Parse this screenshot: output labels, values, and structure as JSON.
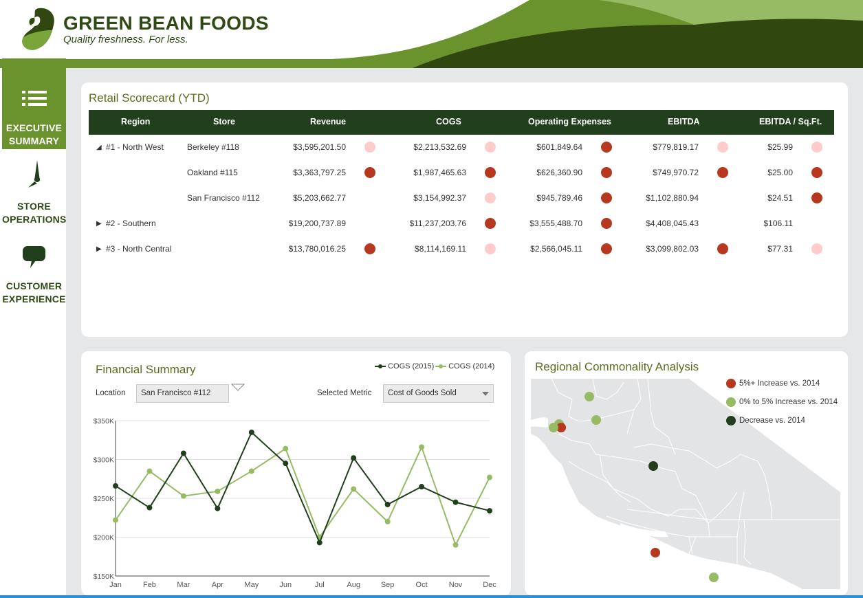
{
  "brand": {
    "name": "GREEN BEAN FOODS",
    "tagline": "Quality freshness. For less."
  },
  "colors": {
    "brand_dark": "#213f1c",
    "brand_mid": "#6a932d",
    "brand_light": "#97bb64",
    "status_red": "#b5381f",
    "status_pink": "#ffcccc",
    "bottom_bar": "#2a8fd0"
  },
  "sidebar": {
    "items": [
      {
        "label_1": "EXECUTIVE",
        "label_2": "SUMMARY",
        "icon": "list-icon",
        "active": true
      },
      {
        "label_1": "STORE",
        "label_2": "OPERATIONS",
        "icon": "compass-needle-icon",
        "active": false
      },
      {
        "label_1": "CUSTOMER",
        "label_2": "EXPERIENCE",
        "icon": "speech-bubble-icon",
        "active": false
      }
    ]
  },
  "scorecard": {
    "title": "Retail Scorecard (YTD)",
    "columns": [
      "Region",
      "Store",
      "Revenue",
      "COGS",
      "Operating Expenses",
      "EBITDA",
      "EBITDA / Sq.Ft."
    ],
    "rows": [
      {
        "region": "#1 - North West",
        "expander": "expanded",
        "store": "Berkeley #118",
        "revenue": "$3,595,201.50",
        "revenue_status": "pink",
        "cogs": "$2,213,532.69",
        "cogs_status": "pink",
        "opex": "$601,849.64",
        "opex_status": "red",
        "ebitda": "$779,819.17",
        "ebitda_status": "pink",
        "ebitda_sqft": "$25.99",
        "ebitda_sqft_status": "pink"
      },
      {
        "region": "",
        "expander": "",
        "store": "Oakland #115",
        "revenue": "$3,363,797.25",
        "revenue_status": "red",
        "cogs": "$1,987,465.63",
        "cogs_status": "red",
        "opex": "$626,360.90",
        "opex_status": "red",
        "ebitda": "$749,970.72",
        "ebitda_status": "red",
        "ebitda_sqft": "$25.00",
        "ebitda_sqft_status": "red"
      },
      {
        "region": "",
        "expander": "",
        "store": "San Francisco #112",
        "revenue": "$5,203,662.77",
        "revenue_status": "",
        "cogs": "$3,154,992.37",
        "cogs_status": "pink",
        "opex": "$945,789.46",
        "opex_status": "red",
        "ebitda": "$1,102,880.94",
        "ebitda_status": "",
        "ebitda_sqft": "$24.51",
        "ebitda_sqft_status": "red"
      },
      {
        "region": "#2 - Southern",
        "expander": "collapsed",
        "store": "",
        "revenue": "$19,200,737.89",
        "revenue_status": "",
        "cogs": "$11,237,203.76",
        "cogs_status": "red",
        "opex": "$3,555,488.70",
        "opex_status": "red",
        "ebitda": "$4,408,045.43",
        "ebitda_status": "",
        "ebitda_sqft": "$106.11",
        "ebitda_sqft_status": ""
      },
      {
        "region": "#3 - North Central",
        "expander": "collapsed",
        "store": "",
        "revenue": "$13,780,016.25",
        "revenue_status": "red",
        "cogs": "$8,114,169.11",
        "cogs_status": "pink",
        "opex": "$2,566,045.11",
        "opex_status": "red",
        "ebitda": "$3,099,802.03",
        "ebitda_status": "red",
        "ebitda_sqft": "$77.31",
        "ebitda_sqft_status": "pink"
      }
    ]
  },
  "financial": {
    "title": "Financial Summary",
    "location_label": "Location",
    "location_value": "San Francisco #112",
    "metric_label": "Selected Metric",
    "metric_value": "Cost of Goods Sold"
  },
  "chart_data": {
    "type": "line",
    "title": "Financial Summary",
    "xlabel": "",
    "ylabel": "",
    "categories": [
      "Jan",
      "Feb",
      "Mar",
      "Apr",
      "May",
      "Jun",
      "Jul",
      "Aug",
      "Sep",
      "Oct",
      "Nov",
      "Dec"
    ],
    "ylim": [
      150000,
      350000
    ],
    "yticks": [
      150000,
      200000,
      250000,
      300000,
      350000
    ],
    "ytick_labels": [
      "$150K",
      "$200K",
      "$250K",
      "$300K",
      "$350K"
    ],
    "grid": true,
    "legend_position": "top-right",
    "series": [
      {
        "name": "COGS (2015)",
        "color": "#213f1c",
        "values": [
          266000,
          238000,
          308000,
          237000,
          335000,
          295000,
          193000,
          302000,
          242000,
          265000,
          245000,
          234000
        ]
      },
      {
        "name": "COGS (2014)",
        "color": "#97bb64",
        "values": [
          222000,
          285000,
          253000,
          259000,
          285000,
          314000,
          200000,
          262000,
          220000,
          316000,
          190000,
          277000
        ]
      }
    ]
  },
  "map": {
    "title": "Regional Commonality Analysis",
    "legend": [
      {
        "label": "5%+ Increase vs. 2014",
        "color": "#b5381f"
      },
      {
        "label": "0% to 5% Increase vs. 2014",
        "color": "#97bb64"
      },
      {
        "label": "Decrease vs. 2014",
        "color": "#213f1c"
      }
    ],
    "markers": [
      {
        "name": "sacramento-area",
        "category": "0% to 5% Increase vs. 2014"
      },
      {
        "name": "stockton-area",
        "category": "0% to 5% Increase vs. 2014"
      },
      {
        "name": "berkeley",
        "category": "0% to 5% Increase vs. 2014"
      },
      {
        "name": "oakland",
        "category": "5%+ Increase vs. 2014"
      },
      {
        "name": "san-francisco",
        "category": "0% to 5% Increase vs. 2014"
      },
      {
        "name": "fresno-area",
        "category": "Decrease vs. 2014"
      },
      {
        "name": "santa-barbara-area",
        "category": "5%+ Increase vs. 2014"
      },
      {
        "name": "los-angeles-area",
        "category": "0% to 5% Increase vs. 2014"
      }
    ]
  }
}
